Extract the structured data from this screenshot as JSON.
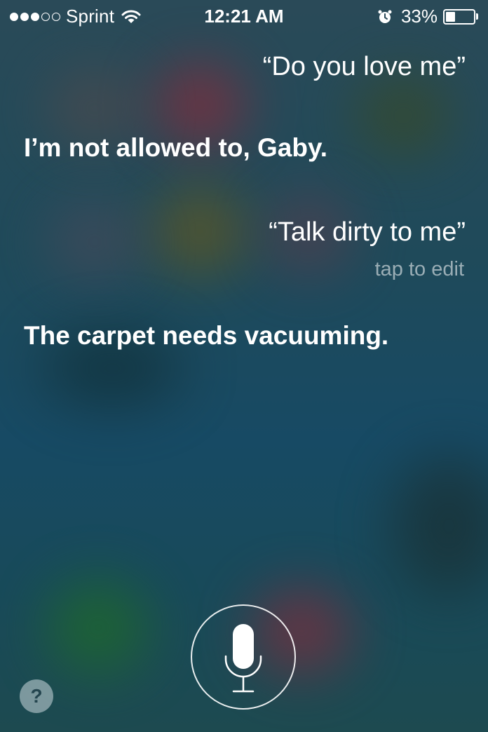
{
  "status_bar": {
    "carrier": "Sprint",
    "time": "12:21 AM",
    "battery_percent_label": "33%",
    "battery_level": 0.33,
    "signal_bars_filled": 3,
    "signal_bars_total": 5
  },
  "conversation": [
    {
      "speaker": "user",
      "text": "“Do you love me”"
    },
    {
      "speaker": "siri",
      "text": "I’m not allowed to, Gaby."
    },
    {
      "speaker": "user",
      "text": "“Talk dirty to me”",
      "hint": "tap to edit"
    },
    {
      "speaker": "siri",
      "text": "The carpet needs vacuuming."
    }
  ],
  "controls": {
    "help_label": "?",
    "mic_icon": "microphone-icon"
  },
  "colors": {
    "background": "#1f4a5a",
    "text": "#ffffff",
    "hint_text": "#a3b3b8"
  }
}
